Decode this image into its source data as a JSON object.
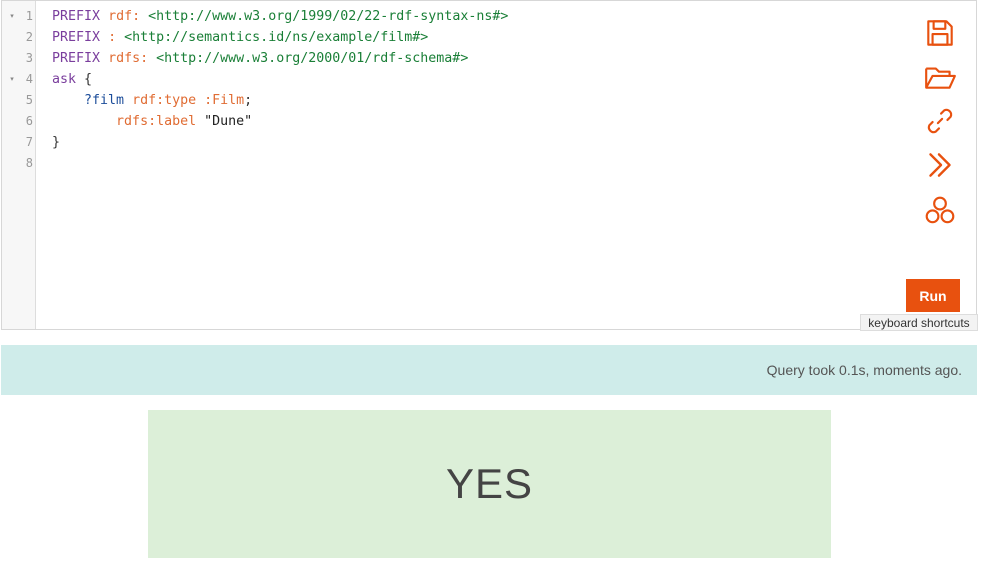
{
  "editor": {
    "line_numbers": [
      "1",
      "2",
      "3",
      "4",
      "5",
      "6",
      "7",
      "8"
    ],
    "fold_markers": [
      "▾",
      "▾"
    ],
    "lines": [
      {
        "kw": "PREFIX",
        "prefix": "rdf:",
        "iri": "<http://www.w3.org/1999/02/22-rdf-syntax-ns#>"
      },
      {
        "kw": "PREFIX",
        "prefix": ":",
        "iri": "<http://semantics.id/ns/example/film#>"
      },
      {
        "kw": "PREFIX",
        "prefix": "rdfs:",
        "iri": "<http://www.w3.org/2000/01/rdf-schema#>"
      },
      {
        "kw": "ask",
        "brace": "{"
      },
      {
        "var": "?film",
        "pred": "rdf:type",
        "obj": ":Film",
        "end": ";"
      },
      {
        "pred": "rdfs:label",
        "str": "\"Dune\""
      },
      {
        "brace": "}"
      }
    ]
  },
  "toolbar": {
    "icons": [
      "save-icon",
      "folder-open-icon",
      "link-icon",
      "double-chevron-right-icon",
      "network-icon"
    ],
    "accent_color": "#e8510f",
    "run_label": "Run",
    "shortcuts_label": "keyboard shortcuts"
  },
  "status": {
    "text": "Query took 0.1s, moments ago."
  },
  "result": {
    "value": "YES"
  }
}
